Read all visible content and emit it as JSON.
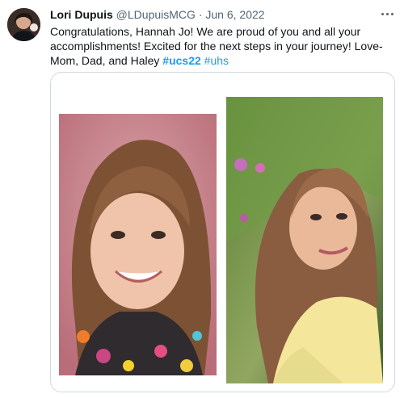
{
  "tweet": {
    "author_name": "Lori Dupuis",
    "handle": "@LDupuisMCG",
    "separator": "·",
    "date": "Jun 6, 2022",
    "text_main": "Congratulations, Hannah Jo! We are proud of you and all your accomplishments! Excited for the next steps in your journey! Love- Mom, Dad, and Haley",
    "hashtags": [
      "#ucs22",
      "#uhs"
    ],
    "more_icon": "more-dots-icon"
  },
  "colors": {
    "link": "#1d9bf0",
    "secondary": "#536471",
    "border": "#cfd9de"
  }
}
